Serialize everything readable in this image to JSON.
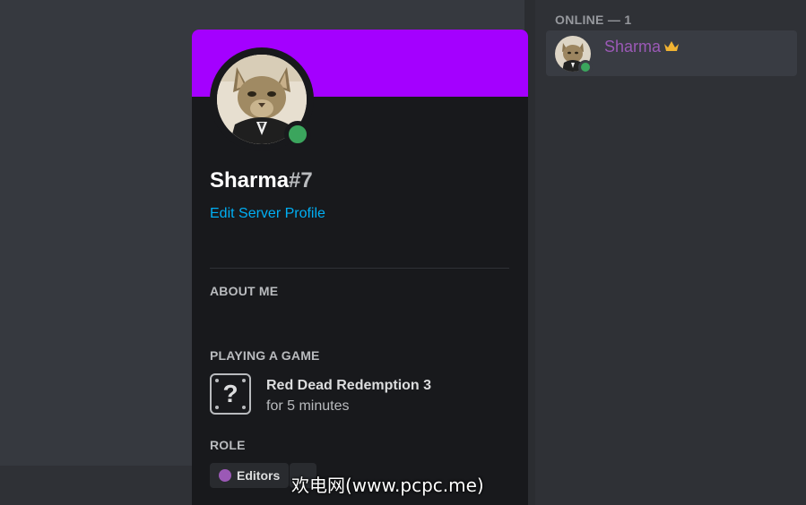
{
  "members": {
    "group_header": "ONLINE — 1",
    "items": [
      {
        "name": "Sharma",
        "status": "online",
        "name_color": "#9b59b6",
        "badge": "crown-icon"
      }
    ]
  },
  "profile": {
    "username": "Sharma",
    "discriminator": "#7",
    "edit_link": "Edit Server Profile",
    "banner_color": "#a400ff",
    "status": "online",
    "sections": {
      "about_me": "ABOUT ME",
      "playing": "PLAYING A GAME",
      "role": "ROLE"
    },
    "game": {
      "title": "Red Dead Redemption 3",
      "duration": "for 5 minutes",
      "icon": "unknown-game-icon"
    },
    "roles": [
      {
        "name": "Editors",
        "color": "#9b59b6"
      }
    ]
  },
  "watermark": "欢电网(www.pcpc.me)"
}
